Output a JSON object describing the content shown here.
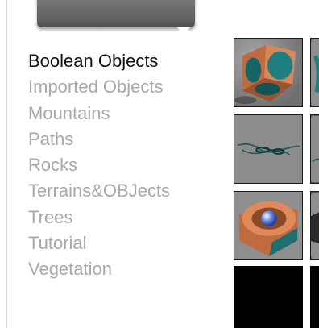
{
  "categories": [
    {
      "label": "Boolean Objects",
      "active": true
    },
    {
      "label": "Imported Objects",
      "active": false
    },
    {
      "label": "Mountains",
      "active": false
    },
    {
      "label": "Paths",
      "active": false
    },
    {
      "label": "Rocks",
      "active": false
    },
    {
      "label": "Terrains&OBJects",
      "active": false
    },
    {
      "label": "Trees",
      "active": false
    },
    {
      "label": "Tutorial",
      "active": false
    },
    {
      "label": "Vegetation",
      "active": false
    }
  ],
  "thumbnails": [
    {
      "icon": "boolean-cube-sphere-icon"
    },
    {
      "icon": "path-curve-icon"
    },
    {
      "icon": "sphere-cutout-icon"
    },
    {
      "icon": "empty-thumbnail"
    }
  ],
  "colors": {
    "active_text": "#111111",
    "inactive_text": "#a8a8a8",
    "thumb_bg": "#8f8f8f",
    "object_orange": "#e0895a",
    "object_teal": "#1f7f7f"
  }
}
